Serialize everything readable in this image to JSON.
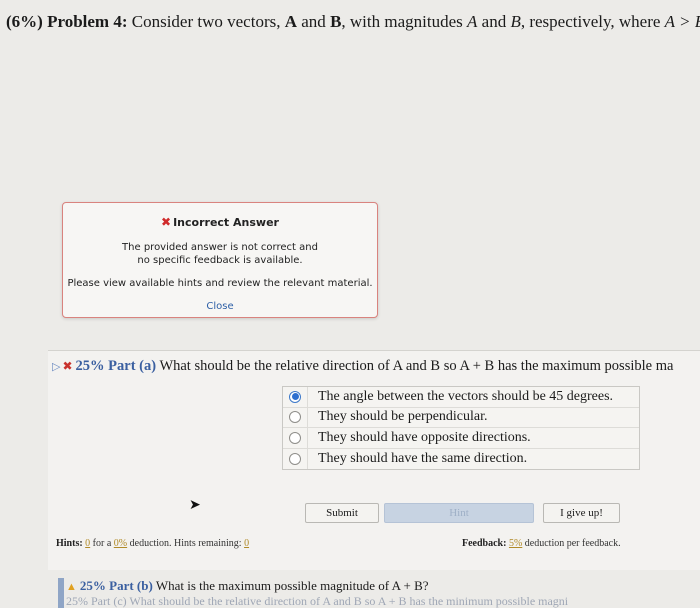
{
  "problem": {
    "prefix": "(6%) Problem 4:",
    "text_1": "Consider two vectors,",
    "vec_a": "A",
    "and": "and",
    "vec_b": "B",
    "text_2": ", with magnitudes",
    "mag_a": "A",
    "mag_b": "B",
    "text_3": ", respectively, where",
    "inequality": "A > B."
  },
  "popup": {
    "title": "Incorrect Answer",
    "message_line1": "The provided answer is not correct and",
    "message_line2": "no specific feedback is available.",
    "hint": "Please view available hints and review the relevant material.",
    "close": "Close"
  },
  "part_a": {
    "percent": "25% Part (a)",
    "question": "What should be the relative direction of A and B so A + B has the maximum possible ma",
    "choices": [
      {
        "label": "The angle between the vectors should be 45 degrees.",
        "selected": true
      },
      {
        "label": "They should be perpendicular.",
        "selected": false
      },
      {
        "label": "They should have opposite directions.",
        "selected": false
      },
      {
        "label": "They should have the same direction.",
        "selected": false
      }
    ],
    "submit": "Submit",
    "hint_button": "Hint",
    "give_up": "I give up!"
  },
  "hints": {
    "label": "Hints:",
    "count": "0",
    "text_for": "for a",
    "deduction": "0%",
    "text_deduction": "deduction. Hints remaining:",
    "remaining": "0"
  },
  "feedback": {
    "label": "Feedback:",
    "deduction": "5%",
    "text": "deduction per feedback."
  },
  "part_b": {
    "percent": "25% Part (b)",
    "question": "What is the maximum possible magnitude of A + B?"
  },
  "part_c": {
    "text": "25% Part (c) What should be the relative direction of A and B so A + B has the minimum possible magni"
  }
}
